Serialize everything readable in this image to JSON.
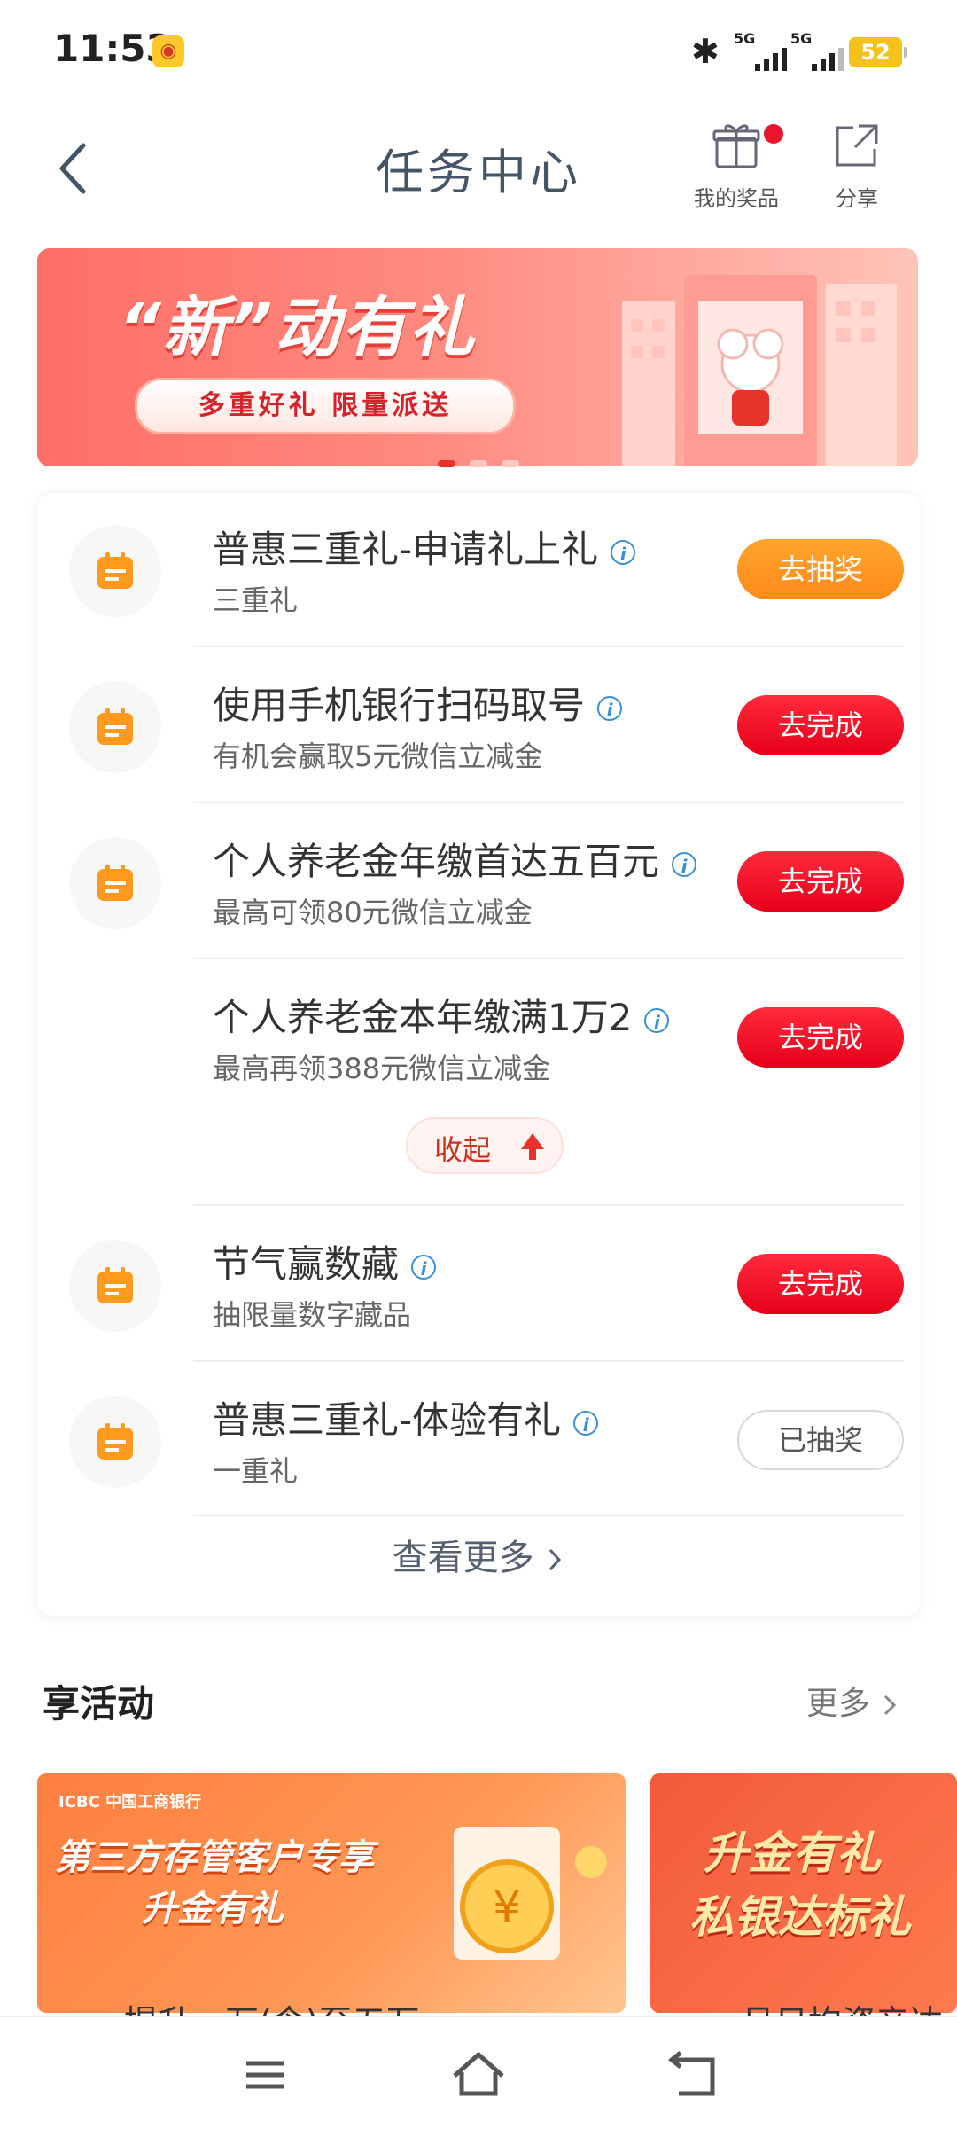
{
  "status_bar": {
    "time": "11:53",
    "network1": "5G",
    "network2": "5G",
    "battery": "52"
  },
  "header": {
    "title": "任务中心",
    "prizes_label": "我的奖品",
    "share_label": "分享"
  },
  "banner": {
    "title": "“新”动有礼",
    "subtitle": "多重好礼 限量派送"
  },
  "tasks": [
    {
      "title": "普惠三重礼-申请礼上礼",
      "subtitle": "三重礼",
      "button": "去抽奖"
    },
    {
      "title": "使用手机银行扫码取号",
      "subtitle": "有机会赢取5元微信立减金",
      "button": "去完成"
    },
    {
      "title": "个人养老金年缴首达五百元",
      "subtitle": "最高可领80元微信立减金",
      "button": "去完成"
    },
    {
      "title": "个人养老金本年缴满1万2",
      "subtitle": "最高再领388元微信立减金",
      "button": "去完成"
    },
    {
      "title": "节气赢数藏",
      "subtitle": "抽限量数字藏品",
      "button": "去完成"
    },
    {
      "title": "普惠三重礼-体验有礼",
      "subtitle": "一重礼",
      "button": "已抽奖"
    }
  ],
  "collapse_label": "收起",
  "view_more": "查看更多",
  "activities": {
    "title": "享活动",
    "more": "更多",
    "card1": {
      "brand": "ICBC 中国工商银行",
      "line1": "第三方存管客户专享",
      "line2": "升金有礼",
      "caption": "提升一万(含)至五万"
    },
    "card2": {
      "line1": "升金有礼",
      "line2": "私银达标礼",
      "caption": "月日均资产达"
    }
  },
  "colors": {
    "accent_red": "#e6001a",
    "accent_orange": "#ff8a1a",
    "icon_orange": "#ff9a1f"
  }
}
